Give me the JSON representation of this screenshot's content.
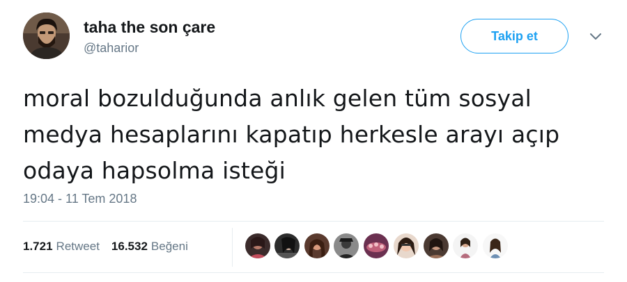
{
  "user": {
    "display_name": "taha the son çare",
    "handle": "@taharior"
  },
  "follow_button": {
    "label": "Takip et"
  },
  "menu": {
    "icon": "chevron-down-icon"
  },
  "tweet": {
    "text_lines": [
      "moral bozulduğunda anlık gelen tüm sosyal",
      "medya hesaplarını kapatıp herkesle arayı açıp",
      "odaya hapsolma isteği"
    ],
    "timestamp": "19:04 - 11 Tem 2018"
  },
  "stats": {
    "retweet_count": "1.721",
    "retweet_label": "Retweet",
    "like_count": "16.532",
    "like_label": "Beğeni"
  },
  "colors": {
    "accent": "#1da1f2",
    "text": "#14171a",
    "secondary_text": "#657786",
    "divider": "#e6ecf0"
  }
}
